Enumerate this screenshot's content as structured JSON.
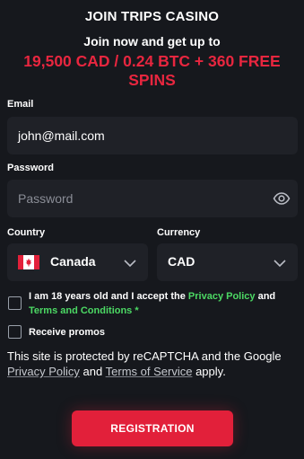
{
  "header": {
    "title": "JOIN TRIPS CASINO",
    "subtitle": "Join now and get up to",
    "promo_line1": "19,500 CAD / 0.24 BTC + 360 FREE",
    "promo_line2": "SPINS"
  },
  "form": {
    "email_label": "Email",
    "email_value": "john@mail.com",
    "password_label": "Password",
    "password_placeholder": "Password",
    "country_label": "Country",
    "country_value": "Canada",
    "currency_label": "Currency",
    "currency_value": "CAD"
  },
  "terms": {
    "text": "I am 18 years old and I accept the",
    "privacy_link": "Privacy Policy",
    "and": "and",
    "terms_link": "Terms and Conditions",
    "required_mark": "*"
  },
  "promos": {
    "label": "Receive promos"
  },
  "captcha": {
    "text_before": "This site is protected by reCAPTCHA and the Google",
    "privacy_link": "Privacy Policy",
    "and": "and",
    "terms_link": "Terms of Service",
    "text_after": "apply."
  },
  "actions": {
    "register_label": "REGISTRATION"
  },
  "colors": {
    "background": "#16181d",
    "field": "#1f2127",
    "accent_red": "#e2203a",
    "link_green": "#4cd964"
  },
  "icons": {
    "password_toggle": "eye-icon",
    "dropdown": "chevron-down-icon",
    "country_flag": "canada-flag-icon"
  }
}
